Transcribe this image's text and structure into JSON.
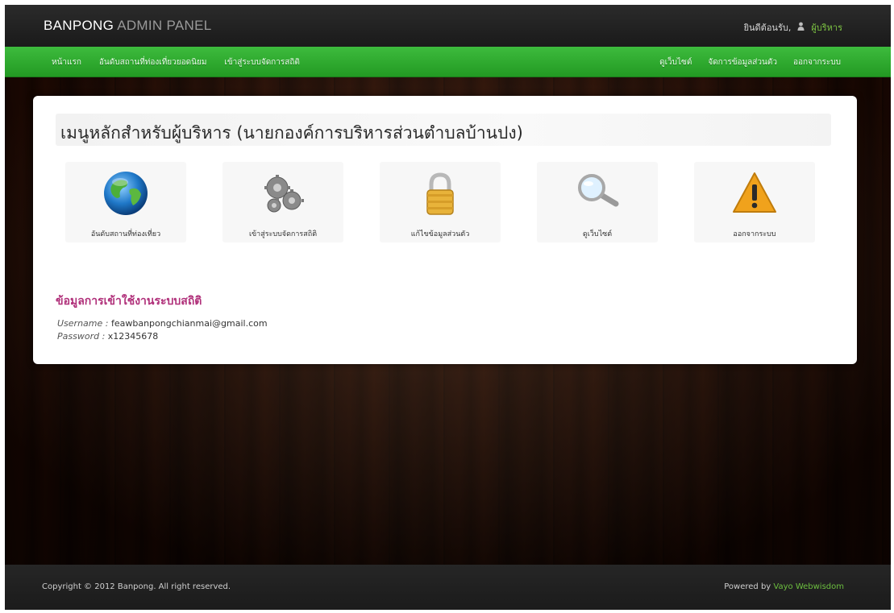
{
  "header": {
    "brand_main": "BANPONG",
    "brand_sub": "ADMIN PANEL",
    "welcome": "ยินดีต้อนรับ,",
    "user_name": "ผู้บริหาร"
  },
  "nav": {
    "left": [
      {
        "label": "หน้าแรก"
      },
      {
        "label": "อันดับสถานที่ท่องเที่ยวยอดนิยม"
      },
      {
        "label": "เข้าสู่ระบบจัดการสถิติ"
      }
    ],
    "right": [
      {
        "label": "ดูเว็บไซต์"
      },
      {
        "label": "จัดการข้อมูลส่วนตัว"
      },
      {
        "label": "ออกจากระบบ"
      }
    ]
  },
  "panel": {
    "title": "เมนูหลักสำหรับผู้บริหาร (นายกองค์การบริหารส่วนตำบลบ้านปง)",
    "menu": [
      {
        "label": "อันดับสถานที่ท่องเที่ยว",
        "icon": "globe-icon"
      },
      {
        "label": "เข้าสู่ระบบจัดการสถิติ",
        "icon": "gears-icon"
      },
      {
        "label": "แก้ไขข้อมูลส่วนตัว",
        "icon": "lock-icon"
      },
      {
        "label": "ดูเว็บไซต์",
        "icon": "magnifier-icon"
      },
      {
        "label": "ออกจากระบบ",
        "icon": "warning-icon"
      }
    ],
    "stats_heading": "ข้อมูลการเข้าใช้งานระบบสถิติ",
    "username_key": "Username :",
    "username_value": "feawbanpongchianmai@gmail.com",
    "password_key": "Password :",
    "password_value": "x12345678"
  },
  "footer": {
    "copyright": "Copyright © 2012 Banpong. All right reserved.",
    "powered_prefix": "Powered by",
    "powered_name": "Vayo Webwisdom"
  },
  "colors": {
    "nav_green": "#2aa82a",
    "stats_heading": "#b0307a",
    "accent_green": "#6cbf3f"
  }
}
